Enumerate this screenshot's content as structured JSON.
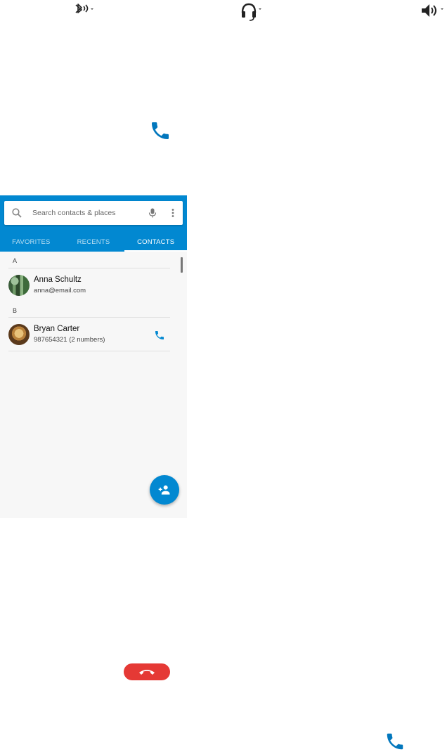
{
  "audio_routes": [
    {
      "name": "bluetooth",
      "icon": "bluetooth-audio-icon"
    },
    {
      "name": "headset",
      "icon": "headset-icon"
    },
    {
      "name": "speaker",
      "icon": "speaker-icon"
    }
  ],
  "colors": {
    "primary": "#0288d1",
    "end_call": "#e53935",
    "call_icon": "#0277bd"
  },
  "search": {
    "placeholder": "Search contacts & places",
    "value": ""
  },
  "tabs": [
    {
      "label": "FAVORITES",
      "active": false
    },
    {
      "label": "RECENTS",
      "active": false
    },
    {
      "label": "CONTACTS",
      "active": true
    }
  ],
  "contacts": {
    "sections": [
      {
        "letter": "A",
        "items": [
          {
            "name": "Anna Schultz",
            "detail": "anna@email.com",
            "has_call": false
          }
        ]
      },
      {
        "letter": "B",
        "items": [
          {
            "name": "Bryan Carter",
            "detail": "987654321 (2 numbers)",
            "has_call": true
          }
        ]
      }
    ]
  },
  "icons": {
    "call": "phone-icon",
    "end_call": "call-end-icon",
    "add_contact": "person-add-icon",
    "search": "search-icon",
    "mic": "microphone-icon",
    "more": "more-vert-icon"
  }
}
